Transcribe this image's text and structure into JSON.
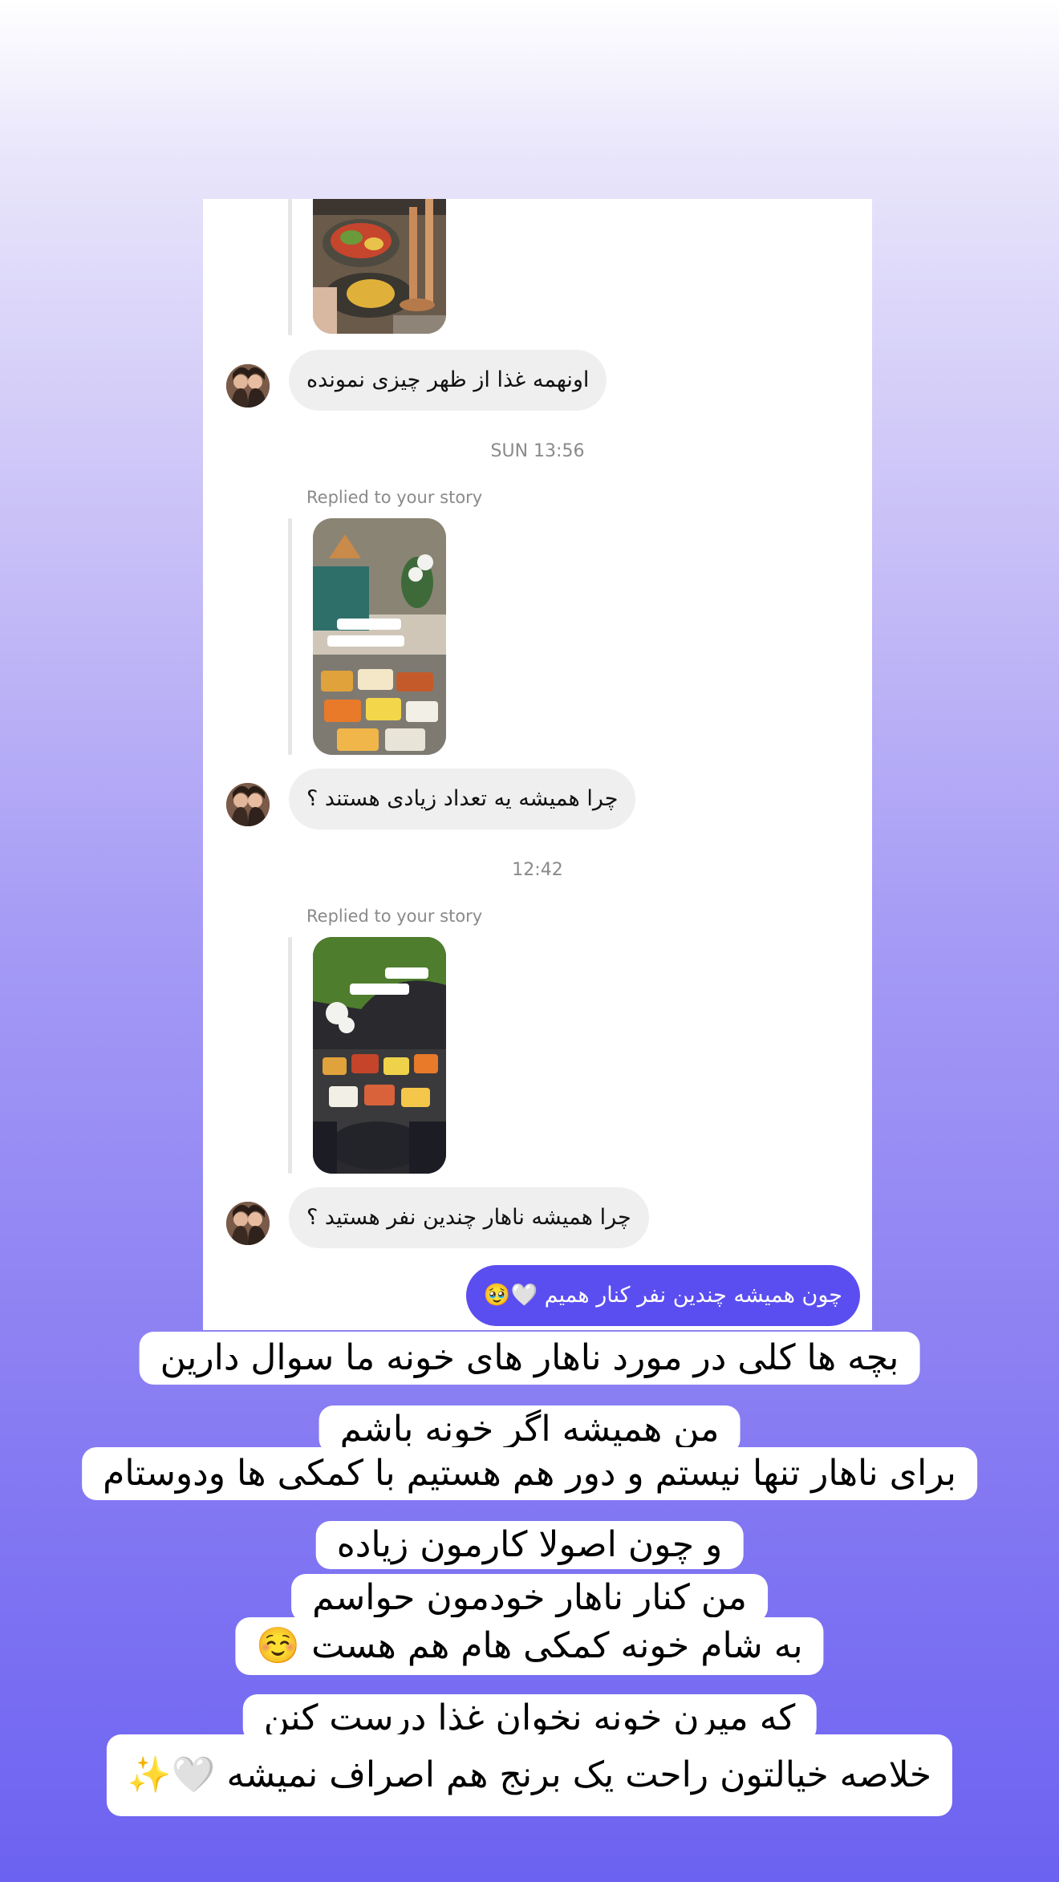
{
  "colors": {
    "accent": "#5b4ef0",
    "received_bubble": "#efefef",
    "timestamp": "#8a8a8a"
  },
  "timestamps": [
    "SUN 13:56",
    "12:42"
  ],
  "messages": [
    {
      "sender": "them",
      "text": "اونهمه غذا از ظهر چیزی نمونده"
    },
    {
      "sender": "them",
      "reply_label": "Replied to your story",
      "text": "چرا همیشه یه تعداد زیادی هستند ؟"
    },
    {
      "sender": "them",
      "reply_label": "Replied to your story",
      "text": "چرا همیشه ناهار چندین نفر هستید ؟"
    },
    {
      "sender": "me",
      "text": "چون همیشه چندین نفر کنار همیم 🤍🥹"
    }
  ],
  "story_thumbnails": [
    {
      "icon": "food-table-thumbnail"
    },
    {
      "icon": "dining-room-thumbnail",
      "stickers": [
        "دلیل هسم ضر یئنشبه ناهار",
        "خوبشت ناری خوشی میشه اوری😊"
      ]
    },
    {
      "icon": "lunch-spread-thumbnail",
      "stickers": [
        "یه وقتی ناهار 🤍",
        "وای علی گلون ذبال🎉"
      ]
    }
  ],
  "caption": {
    "lines": [
      {
        "text": "بچه ها کلی در مورد ناهار های خونه ما سوال دارین",
        "boxed": true
      },
      {
        "text": "من همیشه اگر خونه باشم",
        "boxed": true
      },
      {
        "text": "برای ناهار تنها نیستم و دور هم هستیم با کمکی ها ودوستام",
        "boxed": true
      },
      {
        "text": "و چون اصولا کارمون زیاده",
        "boxed": true
      },
      {
        "text": "من کنار ناهار خودمون حواسم",
        "boxed": true
      },
      {
        "text": "به شام خونه کمکی هام هم هست ☺️",
        "boxed": true
      },
      {
        "text": "که میرن خونه نخوان غذا درست کنن",
        "boxed": true
      },
      {
        "text": "خلاصه خیالتون راحت یک برنج هم اصراف نمیشه 🤍✨",
        "boxed": true
      }
    ]
  }
}
